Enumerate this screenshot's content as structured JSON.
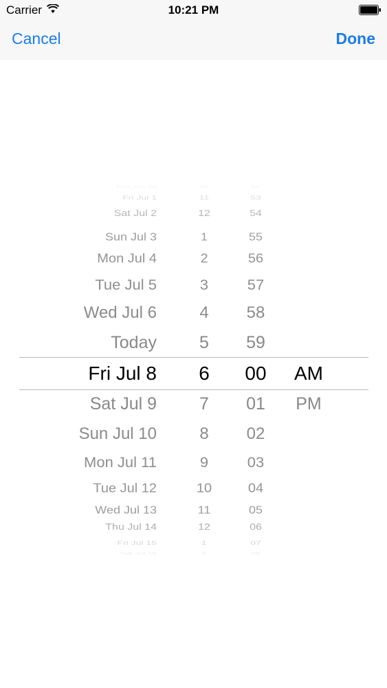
{
  "status_bar": {
    "carrier": "Carrier",
    "time": "10:21 PM",
    "wifi_icon": "wifi-icon",
    "battery_icon": "battery-icon"
  },
  "nav": {
    "cancel_label": "Cancel",
    "done_label": "Done",
    "accent_color": "#1a7cf0"
  },
  "picker": {
    "selected": {
      "date": "Fri Jul 8",
      "hour": "6",
      "minute": "00",
      "ampm": "AM"
    },
    "dates": [
      "Thu Jun 30",
      "Fri Jul 1",
      "Sat Jul 2",
      "Sun Jul 3",
      "Mon Jul 4",
      "Tue Jul 5",
      "Wed Jul 6",
      "Today",
      "Fri Jul 8",
      "Sat Jul 9",
      "Sun Jul 10",
      "Mon Jul 11",
      "Tue Jul 12",
      "Wed Jul 13",
      "Thu Jul 14",
      "Fri Jul 15",
      "Sat Jul 16"
    ],
    "hours": [
      "10",
      "11",
      "12",
      "1",
      "2",
      "3",
      "4",
      "5",
      "6",
      "7",
      "8",
      "9",
      "10",
      "11",
      "12",
      "1",
      "2"
    ],
    "minutes": [
      "52",
      "53",
      "54",
      "55",
      "56",
      "57",
      "58",
      "59",
      "00",
      "01",
      "02",
      "03",
      "04",
      "05",
      "06",
      "07",
      "08"
    ],
    "ampm": [
      "AM",
      "PM"
    ]
  }
}
